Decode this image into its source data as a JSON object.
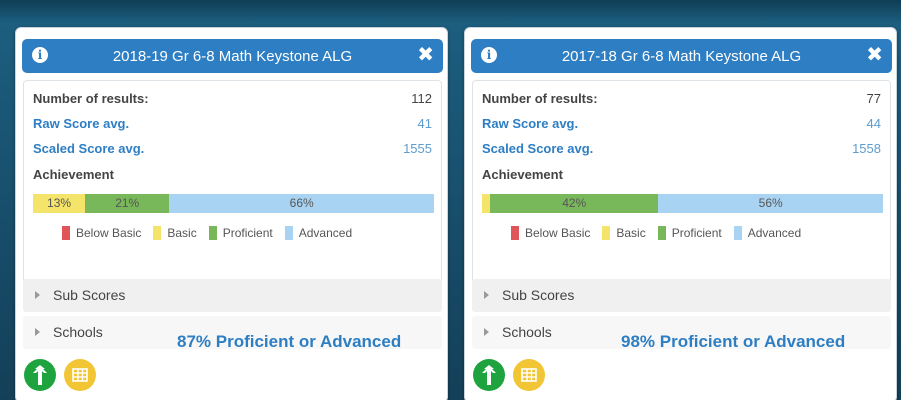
{
  "cards": [
    {
      "title": "2018-19 Gr 6-8 Math Keystone ALG",
      "info_glyph": "i",
      "close_glyph": "✖",
      "num_results_label": "Number of results:",
      "num_results": "112",
      "raw_label": "Raw Score avg.",
      "raw_value": "41",
      "scaled_label": "Scaled Score avg.",
      "scaled_value": "1555",
      "achievement_label": "Achievement",
      "bar": {
        "below": {
          "value": 0,
          "label": ""
        },
        "basic": {
          "value": 13,
          "label": "13%"
        },
        "proficient": {
          "value": 21,
          "label": "21%"
        },
        "advanced": {
          "value": 66,
          "label": "66%"
        }
      },
      "legend": [
        "Below Basic",
        "Basic",
        "Proficient",
        "Advanced"
      ],
      "sub_scores_label": "Sub Scores",
      "schools_label": "Schools",
      "summary": "87% Proficient or Advanced"
    },
    {
      "title": "2017-18 Gr 6-8 Math Keystone ALG",
      "info_glyph": "i",
      "close_glyph": "✖",
      "num_results_label": "Number of results:",
      "num_results": "77",
      "raw_label": "Raw Score avg.",
      "raw_value": "44",
      "scaled_label": "Scaled Score avg.",
      "scaled_value": "1558",
      "achievement_label": "Achievement",
      "bar": {
        "below": {
          "value": 0,
          "label": ""
        },
        "basic": {
          "value": 2,
          "label": ""
        },
        "proficient": {
          "value": 42,
          "label": "42%"
        },
        "advanced": {
          "value": 56,
          "label": "56%"
        }
      },
      "legend": [
        "Below Basic",
        "Basic",
        "Proficient",
        "Advanced"
      ],
      "sub_scores_label": "Sub Scores",
      "schools_label": "Schools",
      "summary": "98% Proficient or Advanced"
    }
  ],
  "colors": {
    "header": "#2d7ec3",
    "below_basic": "#e0555a",
    "basic": "#f4e46a",
    "proficient": "#79b85a",
    "advanced": "#a9d3f2",
    "green_button": "#1fa33f",
    "yellow_button": "#f1c534"
  },
  "icons": {
    "info": "info-icon",
    "close": "close-icon",
    "collapse": "triangle-right-icon",
    "tree_button": "tree-icon",
    "table_button": "grid-table-icon"
  }
}
